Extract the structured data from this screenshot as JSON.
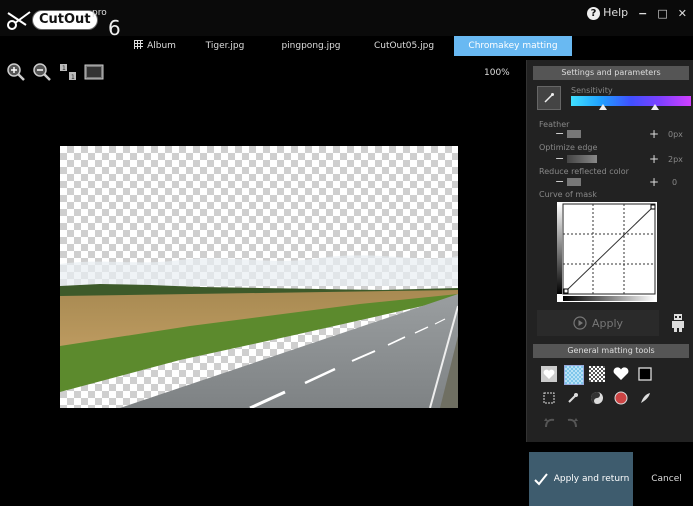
{
  "app": {
    "logo_text": "CutOut",
    "logo_pro": "pro",
    "logo_version": "6"
  },
  "window": {
    "help_label": "Help",
    "minimize_glyph": "−",
    "maximize_glyph": "□",
    "close_glyph": "✕"
  },
  "tabs": [
    {
      "label": "Album",
      "active": false
    },
    {
      "label": "Tiger.jpg",
      "active": false
    },
    {
      "label": "pingpong.jpg",
      "active": false
    },
    {
      "label": "CutOut05.jpg",
      "active": false
    },
    {
      "label": "Chromakey matting",
      "active": true
    }
  ],
  "toolbar": {
    "zoom_level": "100%"
  },
  "panel": {
    "settings_header": "Settings and parameters",
    "sensitivity_label": "Sensitivity",
    "feather_label": "Feather",
    "feather_value": "0px",
    "optimize_label": "Optimize edge",
    "optimize_value": "2px",
    "reduce_label": "Reduce reflected color",
    "reduce_value": "0",
    "curve_label": "Curve of mask",
    "apply_label": "Apply",
    "tools_header": "General matting tools"
  },
  "footer": {
    "apply_return_label": "Apply and return",
    "cancel_label": "Cancel"
  },
  "colors": {
    "accent": "#69b9f2",
    "apply_return_bg": "#3e5c6e"
  }
}
